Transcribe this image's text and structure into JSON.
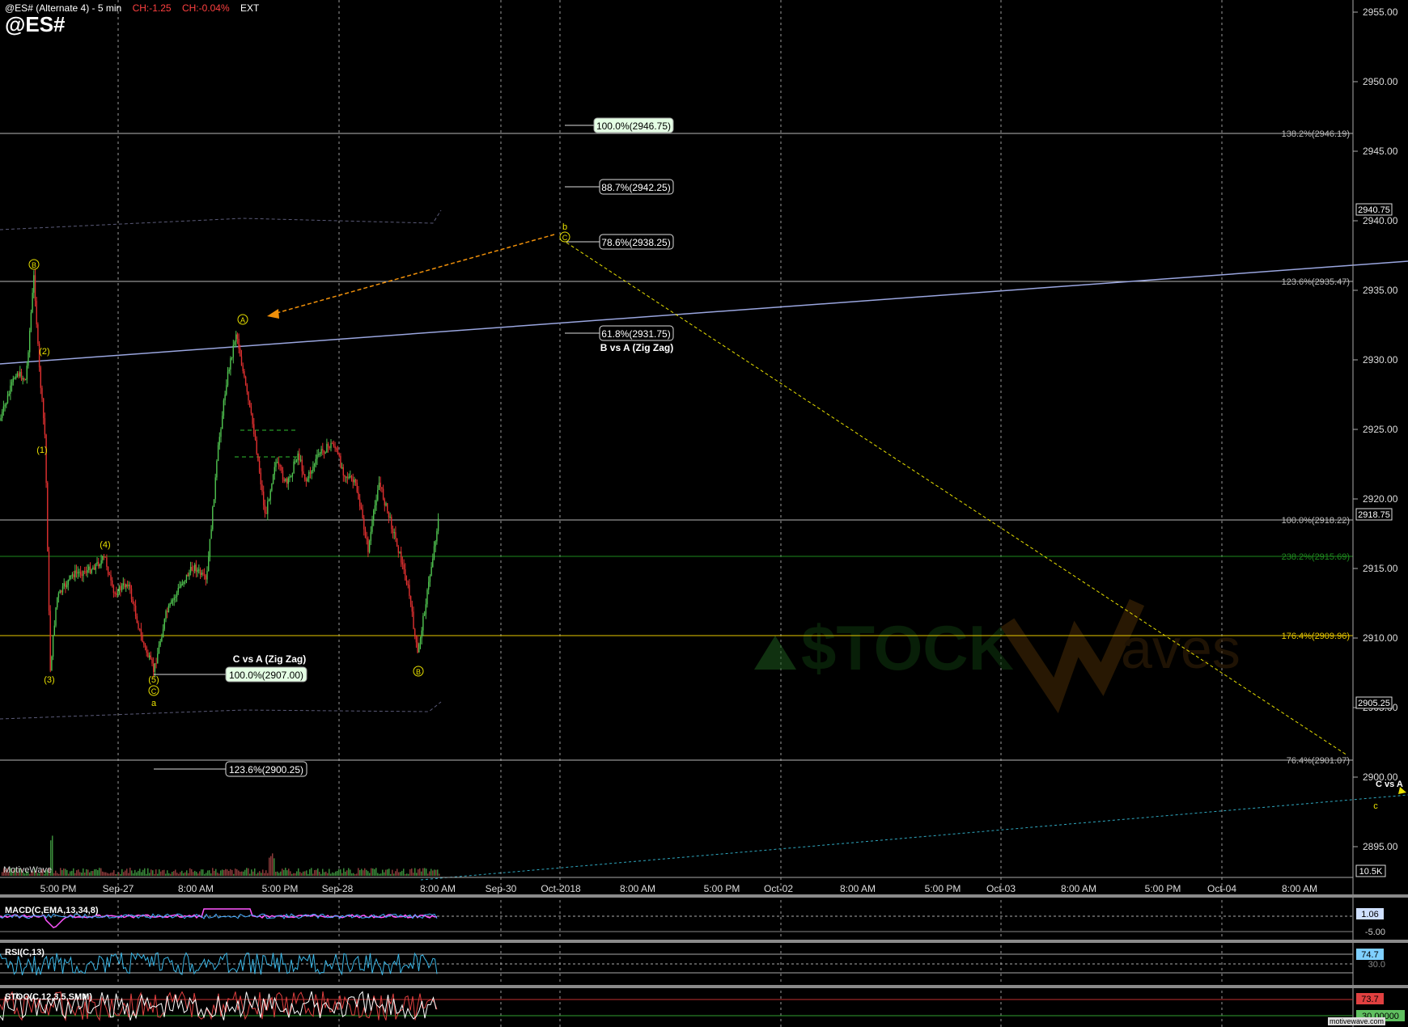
{
  "header": {
    "title": "@ES# (Alternate 4) - 5 min",
    "change": "CH:-1.25",
    "change_pct": "CH:-0.04%",
    "session": "EXT",
    "symbol": "@ES#"
  },
  "brand": "MotiveWave",
  "brand_small": "motivewave.com",
  "colors": {
    "background": "#000000",
    "grid": "#9a9a9a",
    "up_candle": "#4fc24f",
    "down_candle": "#e03030",
    "wave_label": "#e8e000",
    "trendline": "#9aa6e0",
    "channel": "#5a5a78",
    "target_line": "#2fa8c0",
    "negative_change": "#ff4040"
  },
  "price_axis": {
    "labels": [
      "2955.00",
      "2950.00",
      "2945.00",
      "2940.00",
      "2935.00",
      "2930.00",
      "2925.00",
      "2920.00",
      "2915.00",
      "2910.00",
      "2905.00",
      "2900.00",
      "2895.00"
    ],
    "last_price": "2918.75",
    "marker_high": "2940.75",
    "marker_low": "2905.25",
    "volume": "10.5K"
  },
  "time_axis": [
    "5:00 PM",
    "Sep-27",
    "8:00 AM",
    "5:00 PM",
    "Sep-28",
    "8:00 AM",
    "Sep-30",
    "Oct-2018",
    "8:00 AM",
    "5:00 PM",
    "Oct-02",
    "8:00 AM",
    "5:00 PM",
    "Oct-03",
    "8:00 AM",
    "5:00 PM",
    "Oct-04",
    "8:00 AM"
  ],
  "fib_right": [
    {
      "label": "138.2%(2946.19)",
      "color": "#bbbbbb"
    },
    {
      "label": "123.6%(2935.47)",
      "color": "#bbbbbb"
    },
    {
      "label": "100.0%(2918.22)",
      "color": "#bbbbbb"
    },
    {
      "label": "238.2%(2915.69)",
      "color": "#1e8a1e"
    },
    {
      "label": "176.4%(2909.96)",
      "color": "#e8c800"
    },
    {
      "label": "76.4%(2901.07)",
      "color": "#bbbbbb"
    }
  ],
  "fib_boxes": [
    {
      "label": "100.0%(2946.75)",
      "highlight": true
    },
    {
      "label": "88.7%(2942.25)",
      "highlight": false
    },
    {
      "label": "78.6%(2938.25)",
      "highlight": false
    },
    {
      "label": "61.8%(2931.75)",
      "highlight": false
    },
    {
      "label": "100.0%(2907.00)",
      "highlight": true
    },
    {
      "label": "123.6%(2900.25)",
      "highlight": false
    }
  ],
  "fib_titles": {
    "bva": "B vs A (Zig Zag)",
    "cva": "C vs A (Zig Zag)",
    "cva_edge": "C vs A"
  },
  "wave_labels": {
    "B_outer": "B",
    "w2": "(2)",
    "w1": "(1)",
    "w3": "(3)",
    "w4": "(4)",
    "w5": "(5)",
    "C_inner": "C",
    "a_small": "a",
    "A_circle": "A",
    "B_circle": "B",
    "b_small": "b",
    "C_target": "C",
    "c_small": "c"
  },
  "indicators": {
    "macd": {
      "name": "MACD(C,EMA,13,34,8)",
      "value": "1.06",
      "level": "-5.00"
    },
    "rsi": {
      "name": "RSI(C,13)",
      "value": "74.7",
      "level": "30.0"
    },
    "stoch": {
      "name": "STOC(C,12,3,5,SMM)",
      "value": "73.7",
      "level": "30.00000"
    }
  },
  "watermark": {
    "left": "$TOCK",
    "right": "aves"
  }
}
